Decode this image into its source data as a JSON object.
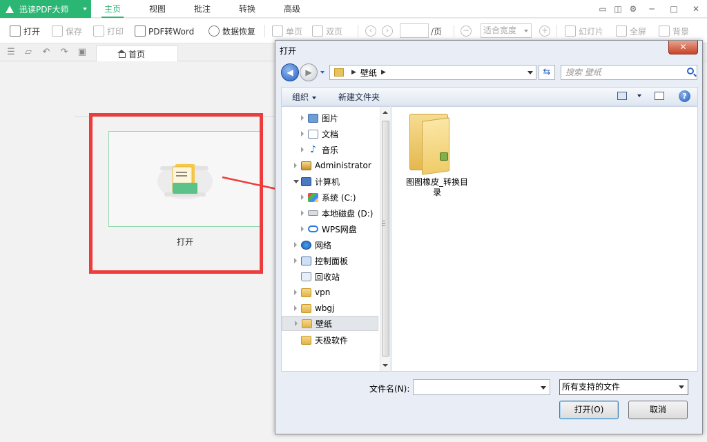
{
  "app": {
    "name": "迅读PDF大师",
    "menu_tabs": [
      "主页",
      "视图",
      "批注",
      "转换",
      "高级"
    ],
    "active_tab": "主页",
    "accent_color": "#2bb673"
  },
  "toolbar": {
    "open": "打开",
    "save": "保存",
    "print": "打印",
    "pdf_to_word": "PDF转Word",
    "data_recovery": "数据恢复",
    "single_page": "单页",
    "double_page": "双页",
    "page_suffix": "/页",
    "zoom_value": "适合宽度",
    "slideshow": "幻灯片",
    "fullscreen": "全屏",
    "background": "背景"
  },
  "doc_tab": {
    "label": "首页"
  },
  "canvas": {
    "open_label": "打开",
    "highlight_color": "#ee3b3b"
  },
  "dialog": {
    "title": "打开",
    "close_glyph": "✕",
    "address": {
      "segment": "壁纸"
    },
    "search_placeholder": "搜索 壁纸",
    "organize": "组织",
    "new_folder": "新建文件夹",
    "help": "?",
    "tree": [
      {
        "label": "图片",
        "icon": "picture-icon"
      },
      {
        "label": "文档",
        "icon": "document-icon"
      },
      {
        "label": "音乐",
        "icon": "music-icon"
      },
      {
        "label": "Administrator",
        "icon": "user-folder-icon"
      },
      {
        "label": "计算机",
        "icon": "computer-icon"
      },
      {
        "label": "系统 (C:)",
        "icon": "windows-drive-icon"
      },
      {
        "label": "本地磁盘 (D:)",
        "icon": "disk-icon"
      },
      {
        "label": "WPS网盘",
        "icon": "cloud-icon"
      },
      {
        "label": "网络",
        "icon": "network-icon"
      },
      {
        "label": "控制面板",
        "icon": "control-panel-icon"
      },
      {
        "label": "回收站",
        "icon": "recycle-bin-icon"
      },
      {
        "label": "vpn",
        "icon": "folder-icon"
      },
      {
        "label": "wbgj",
        "icon": "folder-icon"
      },
      {
        "label": "壁纸",
        "icon": "folder-icon"
      },
      {
        "label": "天极软件",
        "icon": "folder-icon"
      }
    ],
    "selected_tree_item": "壁纸",
    "content_items": [
      {
        "label": "图图橡皮_转换目录",
        "icon": "folder-icon"
      }
    ],
    "filename_label": "文件名(N):",
    "filename_value": "",
    "filetype_value": "所有支持的文件",
    "open_button": "打开(O)",
    "cancel_button": "取消"
  }
}
